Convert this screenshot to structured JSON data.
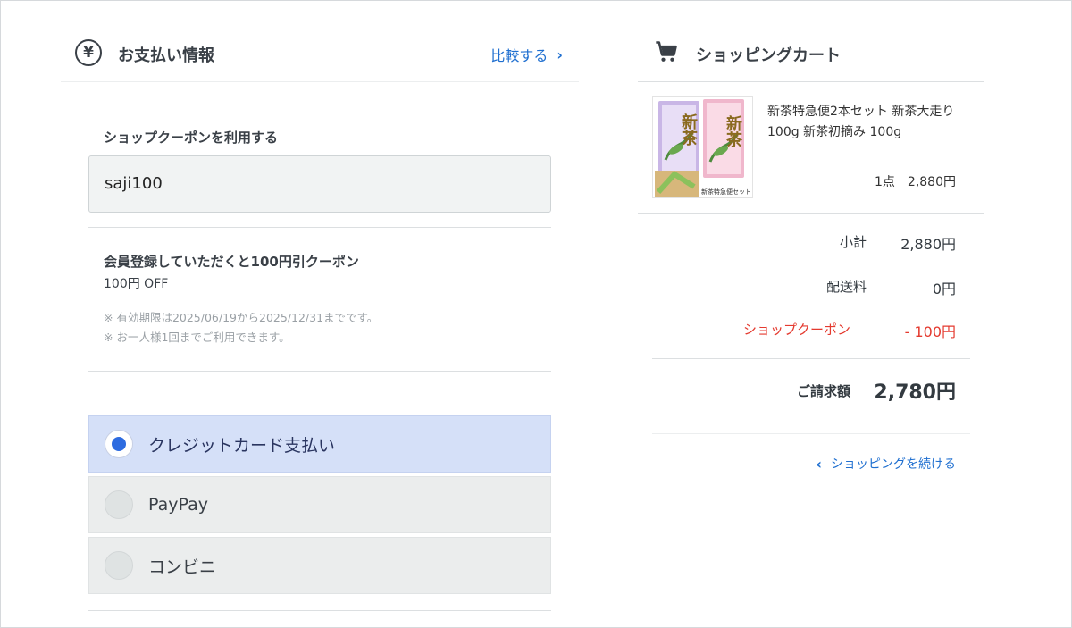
{
  "payment": {
    "title": "お支払い情報",
    "compare_link": "比較する",
    "coupon_label": "ショップクーポンを利用する",
    "coupon_value": "saji100",
    "offer": {
      "title": "会員登録していただくと100円引クーポン",
      "discount": "100円 OFF",
      "note1": "※ 有効期限は2025/06/19から2025/12/31までです。",
      "note2": "※ お一人様1回までご利用できます。"
    },
    "methods": [
      {
        "label": "クレジットカード支払い",
        "selected": true
      },
      {
        "label": "PayPay",
        "selected": false
      },
      {
        "label": "コンビニ",
        "selected": false
      }
    ]
  },
  "cart": {
    "title": "ショッピングカート",
    "item": {
      "name": "新茶特急便2本セット 新茶大走り 100g 新茶初摘み 100g",
      "quantity_price": "1点　2,880円",
      "image_caption_1": "新",
      "image_caption_2": "茶",
      "image_caption_3": "新茶特急便セット"
    },
    "subtotal_label": "小計",
    "subtotal_value": "2,880円",
    "shipping_label": "配送料",
    "shipping_value": "0円",
    "coupon_label": "ショップクーポン",
    "coupon_value": "- 100円",
    "total_label": "ご請求額",
    "total_value": "2,780円",
    "continue_link": "ショッピングを続ける"
  },
  "colors": {
    "link": "#1f6fd0",
    "discount": "#e43a2f",
    "selected_bg": "#d5e0f8",
    "radio_on": "#2d6be0"
  }
}
